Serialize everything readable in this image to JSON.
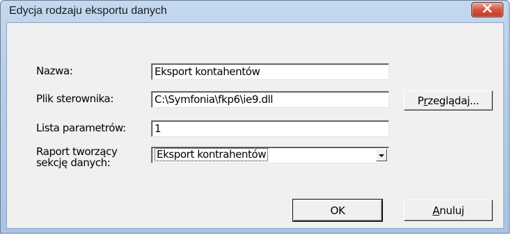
{
  "window": {
    "title": "Edycja rodzaju eksportu danych"
  },
  "icons": {
    "close": "close-icon",
    "dropdown": "chevron-down-icon"
  },
  "form": {
    "name_label": "Nazwa:",
    "name_value": "Eksport kontahentów",
    "driver_label": "Plik sterownika:",
    "driver_value": "C:\\Symfonia\\fkp6\\ie9.dll",
    "browse_label_pre": "P",
    "browse_label_mnemonic": "r",
    "browse_label_post": "zeglądaj...",
    "params_label": "Lista parametrów:",
    "params_value": "1",
    "report_label_line1": "Raport tworzący",
    "report_label_line2": "sekcję danych:",
    "report_value": "Eksport kontrahentów"
  },
  "buttons": {
    "ok_label": "OK",
    "cancel_mnemonic": "A",
    "cancel_rest": "nuluj"
  },
  "colors": {
    "close_button": "#c23a22",
    "title_bar": "#b5cde8",
    "dialog_face": "#f0f0f0"
  }
}
